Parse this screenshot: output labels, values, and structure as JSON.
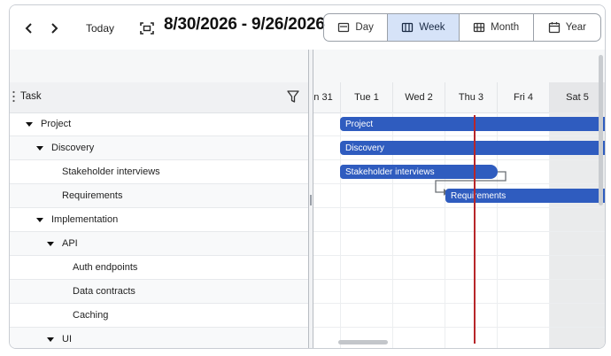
{
  "toolbar": {
    "today_label": "Today",
    "range_label": "8/30/2026 - 9/26/2026",
    "views": [
      {
        "label": "Day",
        "icon": "day-view-icon",
        "active": false
      },
      {
        "label": "Week",
        "icon": "week-view-icon",
        "active": true
      },
      {
        "label": "Month",
        "icon": "month-view-icon",
        "active": false
      },
      {
        "label": "Year",
        "icon": "year-view-icon",
        "active": false
      }
    ]
  },
  "grid": {
    "task_header": "Task",
    "rows": [
      {
        "label": "Project",
        "expandable": true
      },
      {
        "label": "Discovery",
        "expandable": true
      },
      {
        "label": "Stakeholder interviews",
        "expandable": false
      },
      {
        "label": "Requirements",
        "expandable": false
      },
      {
        "label": "Implementation",
        "expandable": true
      },
      {
        "label": "API",
        "expandable": true
      },
      {
        "label": "Auth endpoints",
        "expandable": false
      },
      {
        "label": "Data contracts",
        "expandable": false
      },
      {
        "label": "Caching",
        "expandable": false
      },
      {
        "label": "UI",
        "expandable": true
      }
    ]
  },
  "timeline": {
    "days": [
      "n 31",
      "Tue 1",
      "Wed 2",
      "Thu 3",
      "Fri 4",
      "Sat 5"
    ],
    "weekend_day": "Sat 5",
    "bars": [
      {
        "label": "Project",
        "row": 0
      },
      {
        "label": "Discovery",
        "row": 1
      },
      {
        "label": "Stakeholder interviews",
        "row": 2
      },
      {
        "label": "Requirements",
        "row": 3
      }
    ],
    "today_marker": "Thu 3"
  },
  "colors": {
    "bar": "#2f5cbf",
    "today_line": "#b7262a",
    "active_view": "#d6e3f8"
  }
}
